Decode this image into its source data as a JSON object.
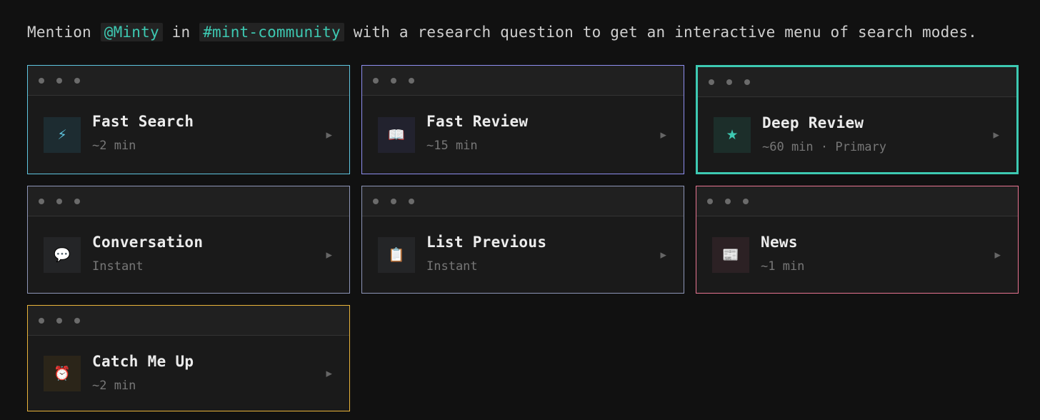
{
  "intro": {
    "prefix": "Mention",
    "mention": "@Minty",
    "middle": "in",
    "channel": "#mint-community",
    "suffix": "with a research question to get an interactive menu of search modes."
  },
  "colors": {
    "fast_search": "#5fc6e0",
    "fast_review": "#8f8ff0",
    "deep_review": "#3dc9b2",
    "conversation": "#8e96b8",
    "list_previous": "#8e96b8",
    "news": "#e87592",
    "catch_me_up": "#e8b33a"
  },
  "cards": [
    {
      "title": "Fast Search",
      "subtitle": "~2 min",
      "icon": "lightning-icon",
      "glyph": "⚡",
      "arrow": "▶"
    },
    {
      "title": "Fast Review",
      "subtitle": "~15 min",
      "icon": "open-book-icon",
      "glyph": "📖",
      "arrow": "▶"
    },
    {
      "title": "Deep Review",
      "subtitle": "~60 min · Primary",
      "icon": "star-icon",
      "glyph": "★",
      "arrow": "▶"
    },
    {
      "title": "Conversation",
      "subtitle": "Instant",
      "icon": "speech-bubble-icon",
      "glyph": "💬",
      "arrow": "▶"
    },
    {
      "title": "List Previous",
      "subtitle": "Instant",
      "icon": "clipboard-icon",
      "glyph": "📋",
      "arrow": "▶"
    },
    {
      "title": "News",
      "subtitle": "~1 min",
      "icon": "newspaper-icon",
      "glyph": "📰",
      "arrow": "▶"
    },
    {
      "title": "Catch Me Up",
      "subtitle": "~2 min",
      "icon": "alarm-clock-icon",
      "glyph": "⏰",
      "arrow": "▶"
    }
  ]
}
